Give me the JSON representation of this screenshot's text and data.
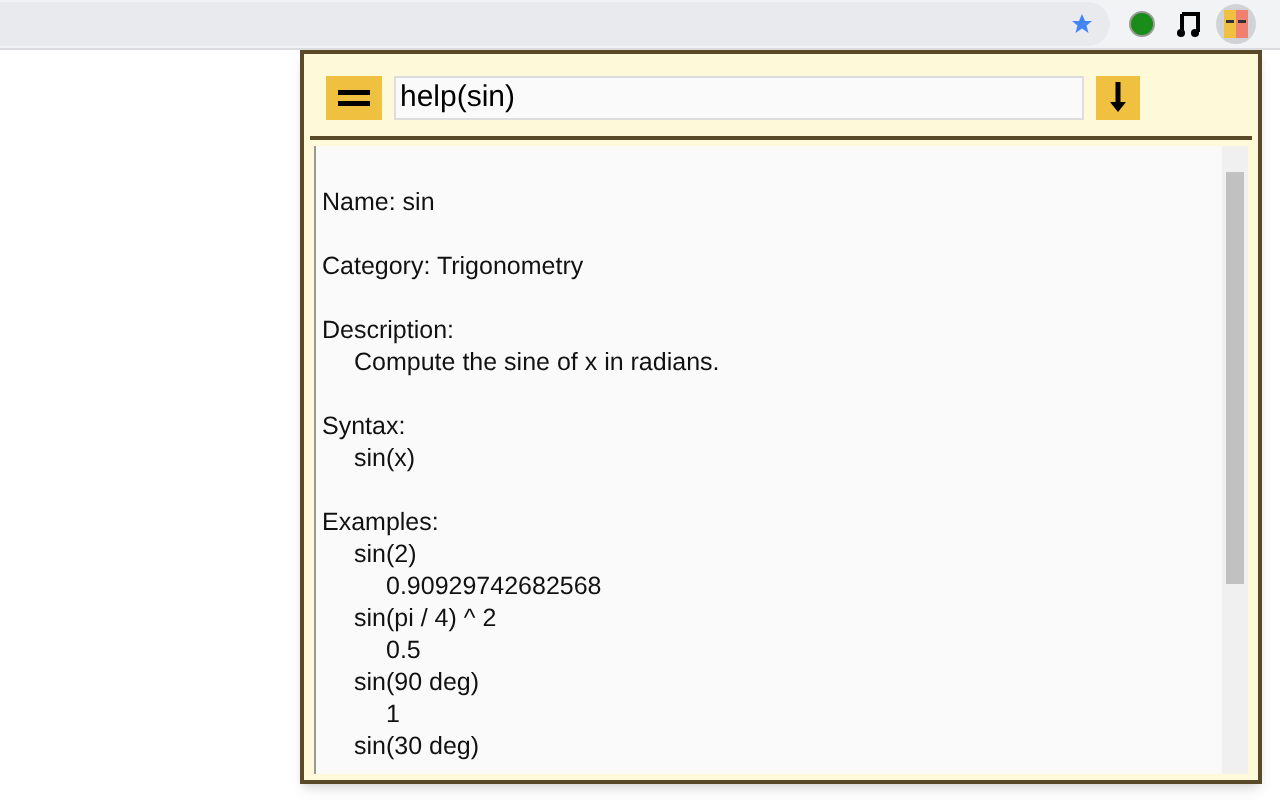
{
  "input": {
    "value": "help(sin)"
  },
  "output": [
    {
      "text": "Name: sin"
    },
    {
      "text": "Category: Trigonometry"
    },
    {
      "text": "Description:",
      "children": [
        {
          "text": "Compute the sine of x in radians."
        }
      ]
    },
    {
      "text": "Syntax:",
      "children": [
        {
          "text": "sin(x)"
        }
      ]
    },
    {
      "text": "Examples:",
      "children": [
        {
          "text": "sin(2)",
          "children": [
            {
              "text": "0.90929742682568"
            }
          ]
        },
        {
          "text": "sin(pi / 4) ^ 2",
          "children": [
            {
              "text": "0.5"
            }
          ]
        },
        {
          "text": "sin(90 deg)",
          "children": [
            {
              "text": "1"
            }
          ]
        },
        {
          "text": "sin(30 deg)"
        }
      ]
    }
  ]
}
